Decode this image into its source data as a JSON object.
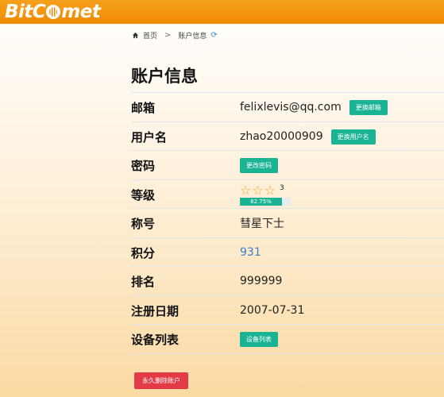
{
  "brand": {
    "logo_text_left": "BitC",
    "logo_text_right": "met",
    "brand_color": "#f08a00"
  },
  "breadcrumb": {
    "home": "首页",
    "separator": ">",
    "current": "账户信息",
    "refresh_icon": "refresh-icon"
  },
  "title": "账户信息",
  "rows": {
    "email": {
      "label": "邮箱",
      "value": "felixlevis@qq.com",
      "button": "更换邮箱"
    },
    "username": {
      "label": "用户名",
      "value": "zhao20000909",
      "button": "更换用户名"
    },
    "password": {
      "label": "密码",
      "button": "更改密码"
    },
    "level": {
      "label": "等级",
      "stars": 3,
      "star_count": "3",
      "progress_text": "82.75%",
      "progress": 0.8275
    },
    "nickname": {
      "label": "称号",
      "value": "彗星下士"
    },
    "points": {
      "label": "积分",
      "value": "931"
    },
    "rank": {
      "label": "排名",
      "value": "999999"
    },
    "register_date": {
      "label": "注册日期",
      "value": "2007-07-31"
    },
    "devices": {
      "label": "设备列表",
      "button": "设备列表"
    }
  },
  "delete_button": "永久删除账户",
  "colors": {
    "accent": "#1ab394",
    "danger": "#e23b47",
    "link": "#3a7fd0",
    "star": "#f5a623"
  }
}
